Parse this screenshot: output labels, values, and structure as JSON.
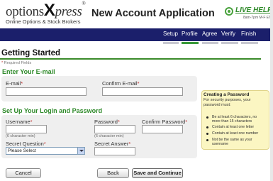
{
  "header": {
    "logo_word": "options",
    "logo_x": "X",
    "logo_press": "press",
    "logo_reg": "®",
    "logo_tagline": "Online Options & Stock Brokers",
    "title": "New Account Application",
    "help_label": "LIVE HELP",
    "help_hours": "8am-7pm M-F ET"
  },
  "nav": {
    "steps": [
      "Setup",
      "Profile",
      "Agree",
      "Verify",
      "Finish"
    ],
    "active_index": 1,
    "colors": {
      "bar": "#1b1f6b",
      "active": "#3a9a3a",
      "inactive": "#c8c8d0"
    }
  },
  "page": {
    "title": "Getting Started",
    "required_note_star": "*",
    "required_note": "Required Fields"
  },
  "email_section": {
    "heading": "Enter Your E-mail",
    "email_label": "E-mail",
    "email_value": "",
    "confirm_label": "Confirm E-mail",
    "confirm_value": "",
    "req_star": "*"
  },
  "login_section": {
    "heading": "Set Up Your Login and Password",
    "username_label": "Username",
    "username_hint": "(6 character min)",
    "username_value": "",
    "password_label": "Password",
    "password_hint": "(6 character min)",
    "password_value": "",
    "confirm_password_label": "Confirm Password",
    "confirm_password_value": "",
    "question_label": "Secret Question",
    "question_selected": "Please Select",
    "answer_label": "Secret Answer",
    "answer_value": "",
    "req_star": "*"
  },
  "tips": {
    "title": "Creating a Password",
    "intro": "For security purposes, your password must:",
    "rules": [
      "Be at least 6 characters, no more than 15 characters",
      "Contain at least one letter",
      "Contain at least one number",
      "Not be the same as your username"
    ]
  },
  "buttons": {
    "cancel": "Cancel",
    "back": "Back",
    "save": "Save and Continue"
  }
}
